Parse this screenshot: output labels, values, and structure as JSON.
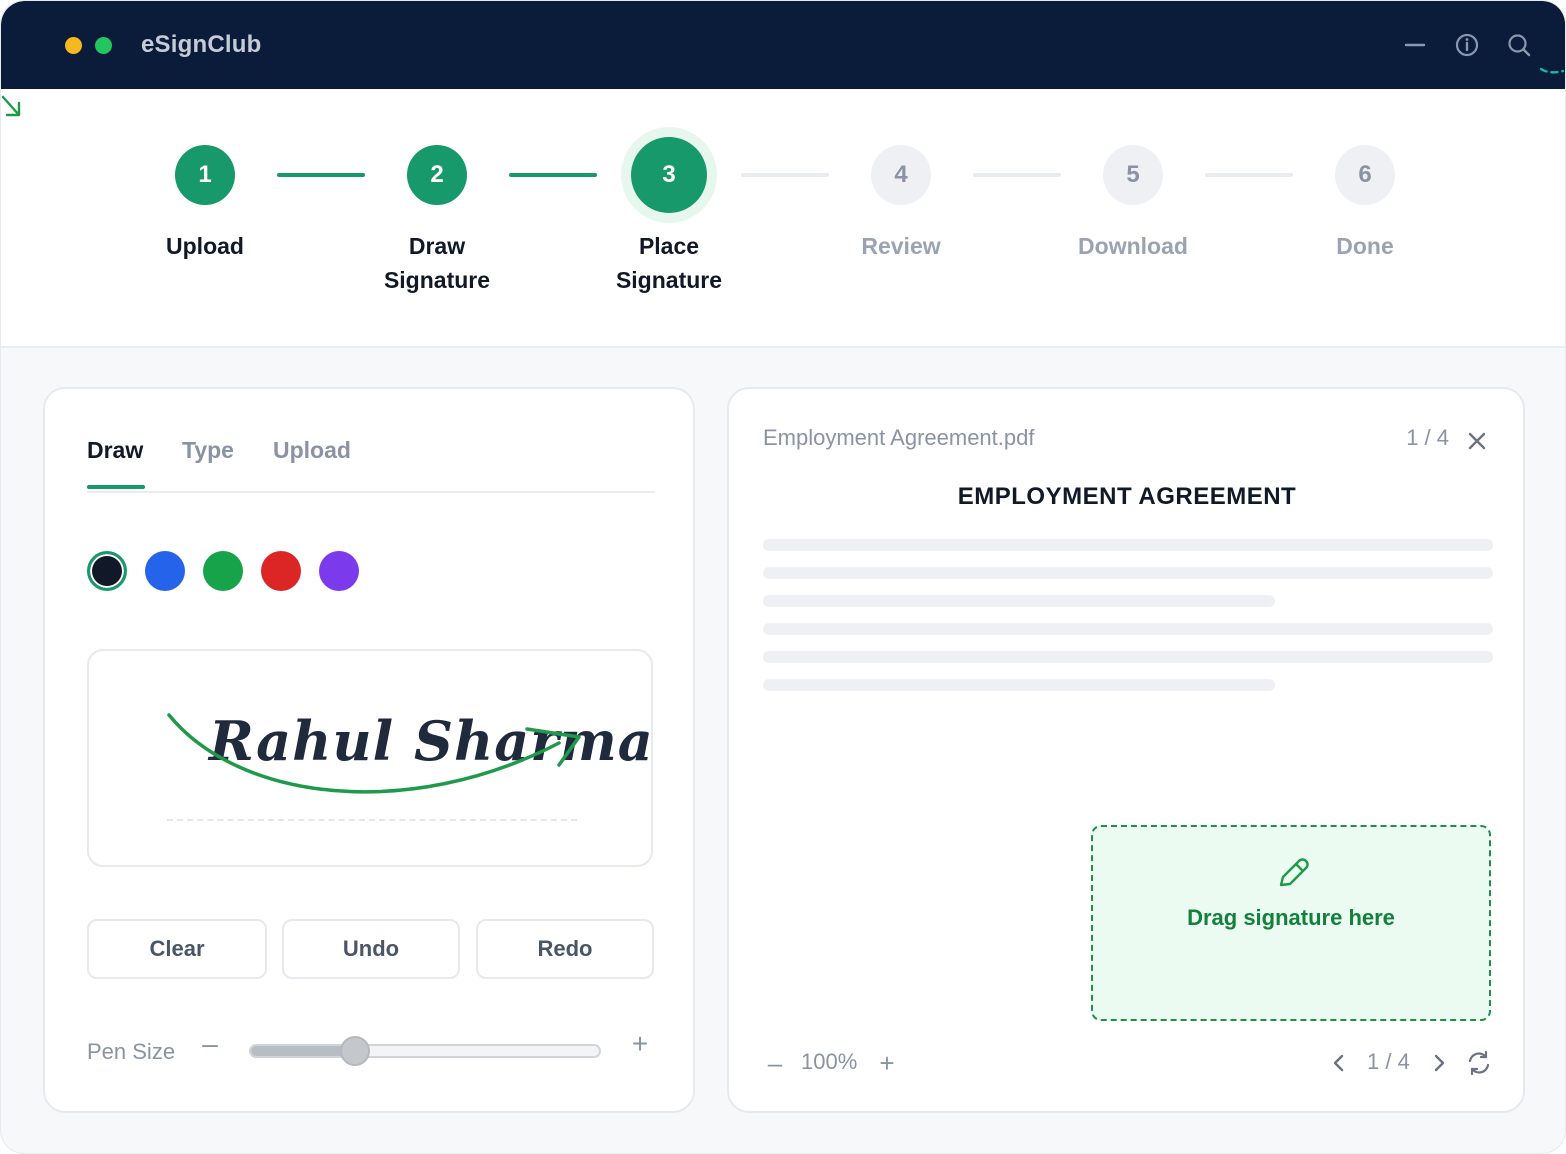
{
  "app": {
    "title": "eSignClub"
  },
  "steps": [
    {
      "number": "1",
      "label_line1": "Upload",
      "label_line2": "",
      "state": "done"
    },
    {
      "number": "2",
      "label_line1": "Draw",
      "label_line2": "Signature",
      "state": "done"
    },
    {
      "number": "3",
      "label_line1": "Place",
      "label_line2": "Signature",
      "state": "active"
    },
    {
      "number": "4",
      "label_line1": "Review",
      "label_line2": "",
      "state": "pending"
    },
    {
      "number": "5",
      "label_line1": "Download",
      "label_line2": "",
      "state": "pending"
    },
    {
      "number": "6",
      "label_line1": "Done",
      "label_line2": "",
      "state": "pending"
    }
  ],
  "signature_panel": {
    "tabs": [
      {
        "label": "Draw",
        "active": true
      },
      {
        "label": "Type",
        "active": false
      },
      {
        "label": "Upload",
        "active": false
      }
    ],
    "colors": [
      "#111827",
      "#2563eb",
      "#16a34a",
      "#dc2626",
      "#7c3aed"
    ],
    "selected_color_index": 0,
    "signature_text": "Rahul Sharma",
    "buttons": {
      "clear": "Clear",
      "undo": "Undo",
      "redo": "Redo"
    },
    "pen_size": {
      "label": "Pen Size",
      "value_fraction": 0.3
    }
  },
  "document_panel": {
    "file_name": "Employment Agreement.pdf",
    "page_indicator": "1 / 4",
    "title": "EMPLOYMENT AGREEMENT",
    "drop_zone_text": "Drag signature here",
    "zoom": "100%",
    "page_indicator_bottom": "1 / 4"
  },
  "colors": {
    "titlebar": "#0b1c3a",
    "accent": "#17996b",
    "drop_zone_border": "#1f8f4a"
  }
}
